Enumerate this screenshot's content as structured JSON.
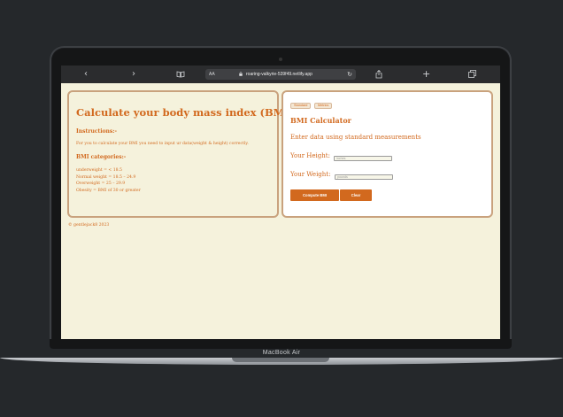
{
  "device": {
    "label": "MacBook Air"
  },
  "browser": {
    "address_aa": "AA",
    "url": "roaring-valkyrie-539f49.netlify.app",
    "icons": [
      "chevron-left",
      "chevron-right",
      "book",
      "lock",
      "reload",
      "share",
      "plus",
      "tabs"
    ]
  },
  "left_card": {
    "title": "Calculate your body mass index (BMI)",
    "instructions_heading": "Instructions:-",
    "instructions_text": "For you to calculate your BMI you need to input ur data(weight & height) correctly.",
    "categories_heading": "BMI categories:-",
    "categories": [
      "underweight = < 18.5",
      "Normal weight = 18.5 – 24.9",
      "Overweight = 25 – 29.9",
      "Obesity = BMI of 30 or greater"
    ]
  },
  "right_card": {
    "tabs": [
      "Standard",
      "Metrics"
    ],
    "title": "BMI Calculator",
    "description": "Enter data using standard measurements",
    "height_label": "Your Height:",
    "height_placeholder": "inches",
    "weight_label": "Your Weight:",
    "weight_placeholder": "pounds",
    "compute_button": "Compute BMI",
    "clear_button": "Clear"
  },
  "footer": {
    "copyright": "© gentlejack8 2023"
  },
  "colors": {
    "accent": "#d2691e",
    "page_bg": "#f5f2dc",
    "card_border": "#c9a27d"
  }
}
